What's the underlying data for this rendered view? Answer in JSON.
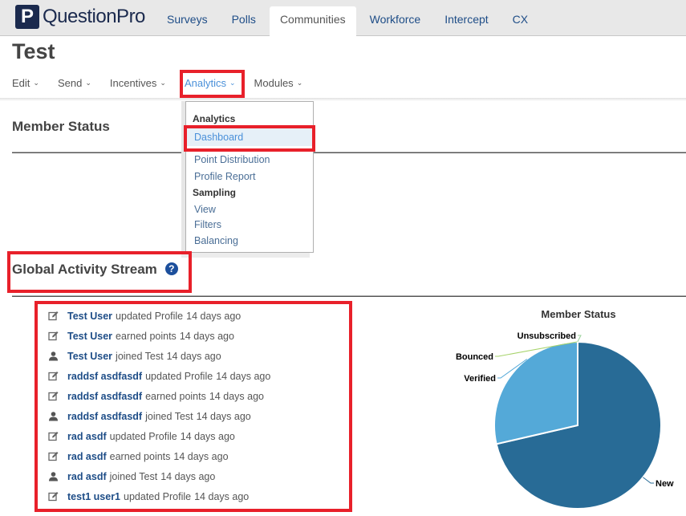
{
  "brand": {
    "logo_mark": "P",
    "name": "QuestionPro",
    "color": "#1b2a4e"
  },
  "top_nav": {
    "tabs": [
      {
        "label": "Surveys",
        "active": false
      },
      {
        "label": "Polls",
        "active": false
      },
      {
        "label": "Communities",
        "active": true
      },
      {
        "label": "Workforce",
        "active": false
      },
      {
        "label": "Intercept",
        "active": false
      },
      {
        "label": "CX",
        "active": false
      }
    ]
  },
  "page": {
    "title": "Test"
  },
  "sub_nav": {
    "items": [
      {
        "label": "Edit",
        "active": false
      },
      {
        "label": "Send",
        "active": false
      },
      {
        "label": "Incentives",
        "active": false
      },
      {
        "label": "Analytics",
        "active": true
      },
      {
        "label": "Modules",
        "active": false
      }
    ]
  },
  "analytics_menu": {
    "groups": [
      {
        "label": "Analytics",
        "items": [
          {
            "label": "Dashboard",
            "selected": true
          },
          {
            "label": "Point Distribution",
            "selected": false
          },
          {
            "label": "Profile Report",
            "selected": false
          }
        ]
      },
      {
        "label": "Sampling",
        "items": [
          {
            "label": "View",
            "selected": false
          },
          {
            "label": "Filters",
            "selected": false
          },
          {
            "label": "Balancing",
            "selected": false
          }
        ]
      }
    ]
  },
  "member_status_section": {
    "title": "Member Status"
  },
  "activity_section": {
    "title": "Global Activity Stream",
    "help_icon": "question-circle-icon",
    "items": [
      {
        "icon": "edit-icon",
        "user": "Test User",
        "action": "updated Profile",
        "time": "14 days ago"
      },
      {
        "icon": "edit-icon",
        "user": "Test User",
        "action": "earned points",
        "time": "14 days ago"
      },
      {
        "icon": "user-icon",
        "user": "Test User",
        "action": "joined Test",
        "time": "14 days ago"
      },
      {
        "icon": "edit-icon",
        "user": "raddsf asdfasdf",
        "action": "updated Profile",
        "time": "14 days ago"
      },
      {
        "icon": "edit-icon",
        "user": "raddsf asdfasdf",
        "action": "earned points",
        "time": "14 days ago"
      },
      {
        "icon": "user-icon",
        "user": "raddsf asdfasdf",
        "action": "joined Test",
        "time": "14 days ago"
      },
      {
        "icon": "edit-icon",
        "user": "rad asdf",
        "action": "updated Profile",
        "time": "14 days ago"
      },
      {
        "icon": "edit-icon",
        "user": "rad asdf",
        "action": "earned points",
        "time": "14 days ago"
      },
      {
        "icon": "user-icon",
        "user": "rad asdf",
        "action": "joined Test",
        "time": "14 days ago"
      },
      {
        "icon": "edit-icon",
        "user": "test1 user1",
        "action": "updated Profile",
        "time": "14 days ago"
      }
    ]
  },
  "highlight_color": "#e8202a",
  "chart_data": {
    "type": "pie",
    "title": "Member Status",
    "slices": [
      {
        "label": "New",
        "value": 71.4,
        "color": "#286b96"
      },
      {
        "label": "Verified",
        "value": 28.6,
        "color": "#54a9d8"
      },
      {
        "label": "Bounced",
        "value": 0,
        "color": "#a6d36a"
      },
      {
        "label": "Unsubscribed",
        "value": 0,
        "color": "#9bd29b"
      }
    ],
    "start_angle_deg": 0,
    "direction": "clockwise",
    "legend": "none (data labels with connectors)"
  }
}
